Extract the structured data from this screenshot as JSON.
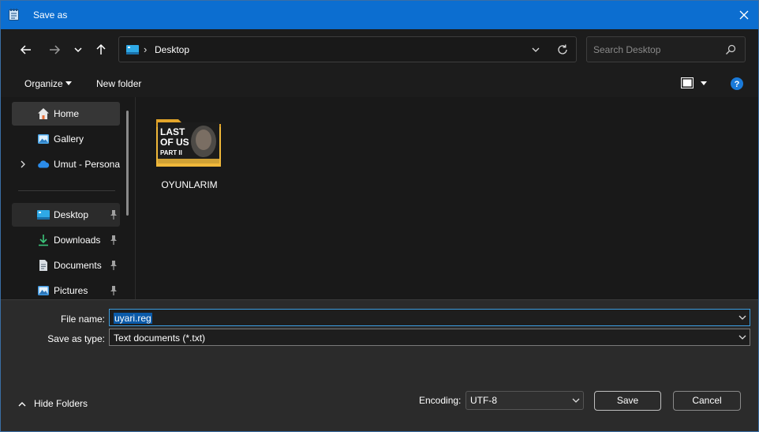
{
  "window": {
    "title": "Save as"
  },
  "address": {
    "separator": "›",
    "location": "Desktop"
  },
  "search": {
    "placeholder": "Search Desktop"
  },
  "toolbar": {
    "organize": "Organize",
    "new_folder": "New folder"
  },
  "sidebar": {
    "items": [
      {
        "label": "Home",
        "icon": "home-icon"
      },
      {
        "label": "Gallery",
        "icon": "gallery-icon"
      },
      {
        "label": "Umut - Personal",
        "icon": "onedrive-icon"
      },
      {
        "label": "Desktop",
        "icon": "desktop-icon"
      },
      {
        "label": "Downloads",
        "icon": "download-icon"
      },
      {
        "label": "Documents",
        "icon": "documents-icon"
      },
      {
        "label": "Pictures",
        "icon": "pictures-icon"
      }
    ]
  },
  "files": [
    {
      "name": "OYUNLARIM",
      "thumb_lines": [
        "LAST",
        "OF US",
        "PART II"
      ]
    }
  ],
  "form": {
    "file_name_label": "File name:",
    "file_name_value": "uyari.reg",
    "type_label": "Save as type:",
    "type_value": "Text documents (*.txt)",
    "encoding_label": "Encoding:",
    "encoding_value": "UTF-8",
    "hide_folders": "Hide Folders",
    "save": "Save",
    "cancel": "Cancel"
  },
  "colors": {
    "accent": "#0c6ed0",
    "selection": "#0b5aa8",
    "folder": "#f0b83a"
  }
}
